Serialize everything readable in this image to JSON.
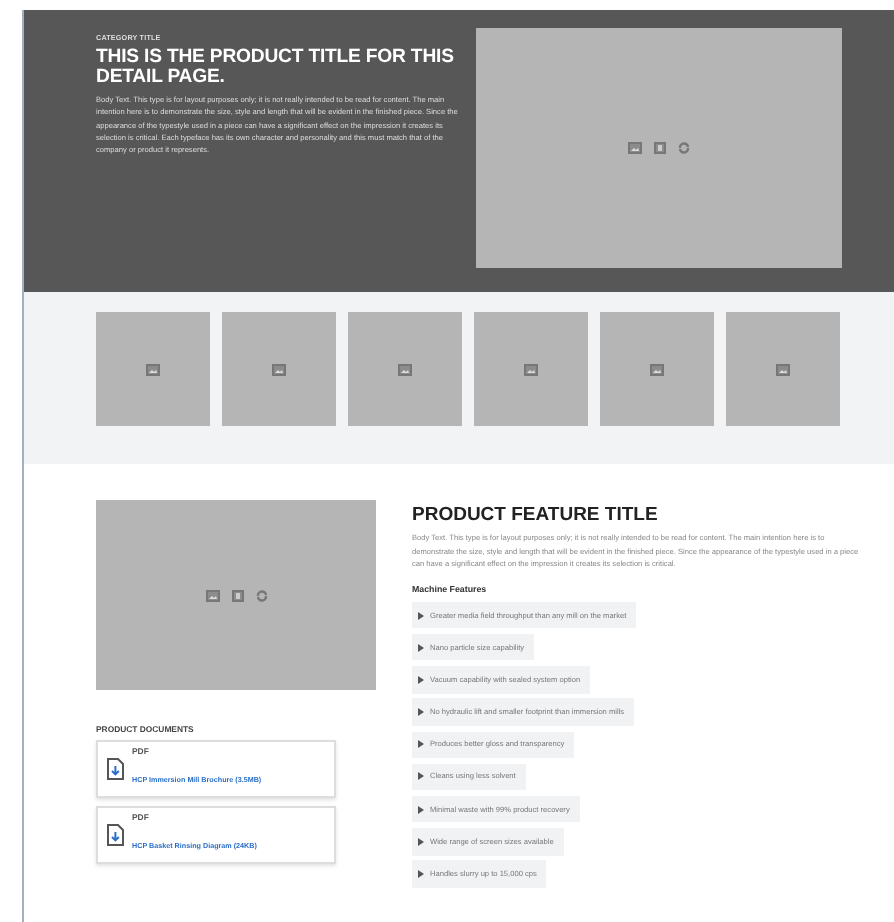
{
  "hero": {
    "category": "CATEGORY TITLE",
    "title": "THIS IS THE PRODUCT TITLE FOR THIS DETAIL PAGE.",
    "body": "Body Text. This type is for layout purposes only; it is not really intended to be read for content. The main intention here is to demonstrate the size, style and length that will be evident in the finished piece. Since the appearance of the typestyle used in a piece can have a significant effect on the impression it creates its selection is critical. Each typeface has its own character and personality and this must match that of the company or product it represents.",
    "media": {
      "icons": [
        {
          "kind": "image"
        },
        {
          "kind": "video"
        },
        {
          "kind": "rotate"
        }
      ]
    }
  },
  "thumbnails": [
    {
      "kind": "image"
    },
    {
      "kind": "image"
    },
    {
      "kind": "image"
    },
    {
      "kind": "image"
    },
    {
      "kind": "image"
    },
    {
      "kind": "image"
    }
  ],
  "detail": {
    "media": {
      "icons": [
        {
          "kind": "image"
        },
        {
          "kind": "video"
        },
        {
          "kind": "rotate"
        }
      ]
    },
    "documents": {
      "heading": "PRODUCT DOCUMENTS",
      "items": [
        {
          "type": "PDF",
          "name": "HCP Immersion Mill Brochure",
          "size": "(3.5MB)"
        },
        {
          "type": "PDF",
          "name": "HCP Basket Rinsing Diagram",
          "size": "(24KB)"
        }
      ]
    },
    "title": "PRODUCT FEATURE TITLE",
    "body": "Body Text. This type is for layout purposes only; it is not really intended to be read for content. The main intention here is to demonstrate the size, style and length that will be evident in the finished piece. Since the appearance of the typestyle used in a piece can have a significant effect on the impression it creates its selection is critical.",
    "features_heading": "Machine Features",
    "features": [
      "Greater media field throughput than any mill on the market",
      "Nano particle size capability",
      "Vacuum capability with sealed system option",
      "No hydraulic lift and smaller footprint than immersion mills",
      "Produces better gloss and transparency",
      "Cleans using less solvent",
      "Minimal waste with 99% product recovery",
      "Wide range of screen sizes available",
      "Handles slurry up to 15,000 cps"
    ]
  }
}
